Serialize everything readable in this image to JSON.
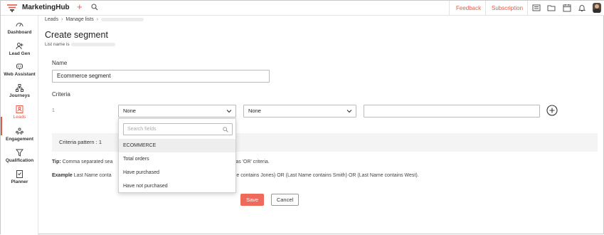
{
  "app": {
    "title": "MarketingHub",
    "brand_color": "#e05a47"
  },
  "topbar": {
    "feedback_label": "Feedback",
    "subscription_label": "Subscription",
    "icons": [
      "plus-icon",
      "search-icon",
      "list-icon",
      "folder-icon",
      "calendar-icon",
      "bell-icon",
      "avatar"
    ]
  },
  "sidebar": {
    "items": [
      {
        "label": "Dashboard",
        "icon": "dashboard-icon"
      },
      {
        "label": "Lead Gen",
        "icon": "lead-gen-icon"
      },
      {
        "label": "Web Assistant",
        "icon": "web-assistant-icon"
      },
      {
        "label": "Journeys",
        "icon": "journeys-icon"
      },
      {
        "label": "Leads",
        "icon": "leads-icon",
        "active": true
      },
      {
        "label": "Engagement",
        "icon": "engagement-icon"
      },
      {
        "label": "Qualification",
        "icon": "qualification-icon"
      },
      {
        "label": "Planner",
        "icon": "planner-icon"
      }
    ]
  },
  "breadcrumb": {
    "items": [
      "Leads",
      "Manage lists"
    ]
  },
  "page": {
    "title": "Create segment",
    "list_name_label": "List name is",
    "name_label": "Name",
    "name_value": "Ecommerce segment",
    "criteria_label": "Criteria",
    "row_number": "1",
    "field_select": "None",
    "operator_select": "None",
    "value_input": "",
    "criteria_pattern": "Criteria pattern : 1",
    "tip_label": "Tip:",
    "tip_text": "Comma separated sea",
    "tip_text_2": "d as 'OR' criteria.",
    "example_label": "Example",
    "example_text": "Last Name conta",
    "example_text_2": "ame contains Jones) OR (Last Name contains Smith) OR (Last Name contains West).",
    "save_label": "Save",
    "cancel_label": "Cancel"
  },
  "dropdown": {
    "search_placeholder": "Search fields",
    "items": [
      {
        "label": "ECOMMERCE",
        "highlighted": true
      },
      {
        "label": "Total orders"
      },
      {
        "label": "Have purchased"
      },
      {
        "label": "Have not purchased"
      }
    ]
  }
}
